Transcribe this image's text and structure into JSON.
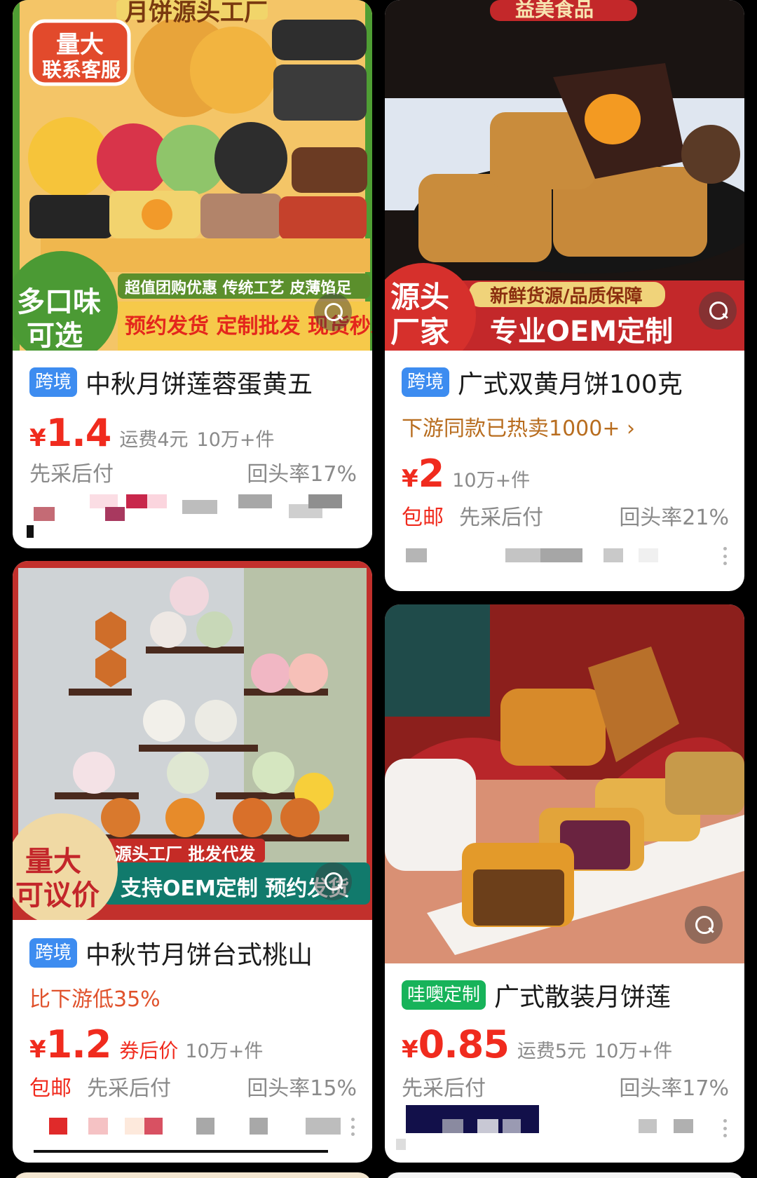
{
  "products": [
    {
      "id": "p1",
      "image": {
        "top_banner": "月饼源头工厂",
        "badge_tl_line1": "量大",
        "badge_tl_line2": "联系客服",
        "badge_bl_line1": "多口味",
        "badge_bl_line2": "可选",
        "strip_top": "超值团购优惠 传统工艺 皮薄馅足",
        "strip_bottom": "预约发货 定制批发 现货秒发"
      },
      "tag": "跨境",
      "title": "中秋月饼莲蓉蛋黄五",
      "currency": "¥",
      "price": "1.4",
      "shipping": "运费4元",
      "moq": "10万+件",
      "pay_later": "先采后付",
      "repeat_rate": "回头率17%"
    },
    {
      "id": "p2",
      "image": {
        "top_banner": "益美食品",
        "badge_bl_line1": "源头",
        "badge_bl_line2": "厂家",
        "strip_top": "新鲜货源/品质保障",
        "strip_bottom": "专业OEM定制"
      },
      "tag": "跨境",
      "title": "广式双黄月饼100克",
      "promo": "下游同款已热卖1000+ ›",
      "currency": "¥",
      "price": "2",
      "moq": "10万+件",
      "free_shipping": "包邮",
      "pay_later": "先采后付",
      "repeat_rate": "回头率21%"
    },
    {
      "id": "p3",
      "image": {
        "badge_bl_line1": "量大",
        "badge_bl_line2": "可议价",
        "strip_top": "源头工厂 批发代发",
        "strip_bottom": "支持OEM定制 预约发货"
      },
      "tag": "跨境",
      "title": "中秋节月饼台式桃山",
      "promo": "比下游低35%",
      "currency": "¥",
      "price": "1.2",
      "price_note": "券后价",
      "moq": "10万+件",
      "free_shipping": "包邮",
      "pay_later": "先采后付",
      "repeat_rate": "回头率15%"
    },
    {
      "id": "p4",
      "tag": "哇噢定制",
      "title": "广式散装月饼莲",
      "currency": "¥",
      "price": "0.85",
      "shipping": "运费5元",
      "moq": "10万+件",
      "pay_later": "先采后付",
      "repeat_rate": "回头率17%"
    }
  ],
  "icons": {
    "image_search": "image-search-icon",
    "more": "more-vertical-icon"
  },
  "colors": {
    "price_red": "#f02b1e",
    "tag_blue": "#3d8cf0",
    "tag_green": "#17b35a",
    "promo_orange": "#e0522c",
    "promo_brown": "#b86d1f"
  }
}
